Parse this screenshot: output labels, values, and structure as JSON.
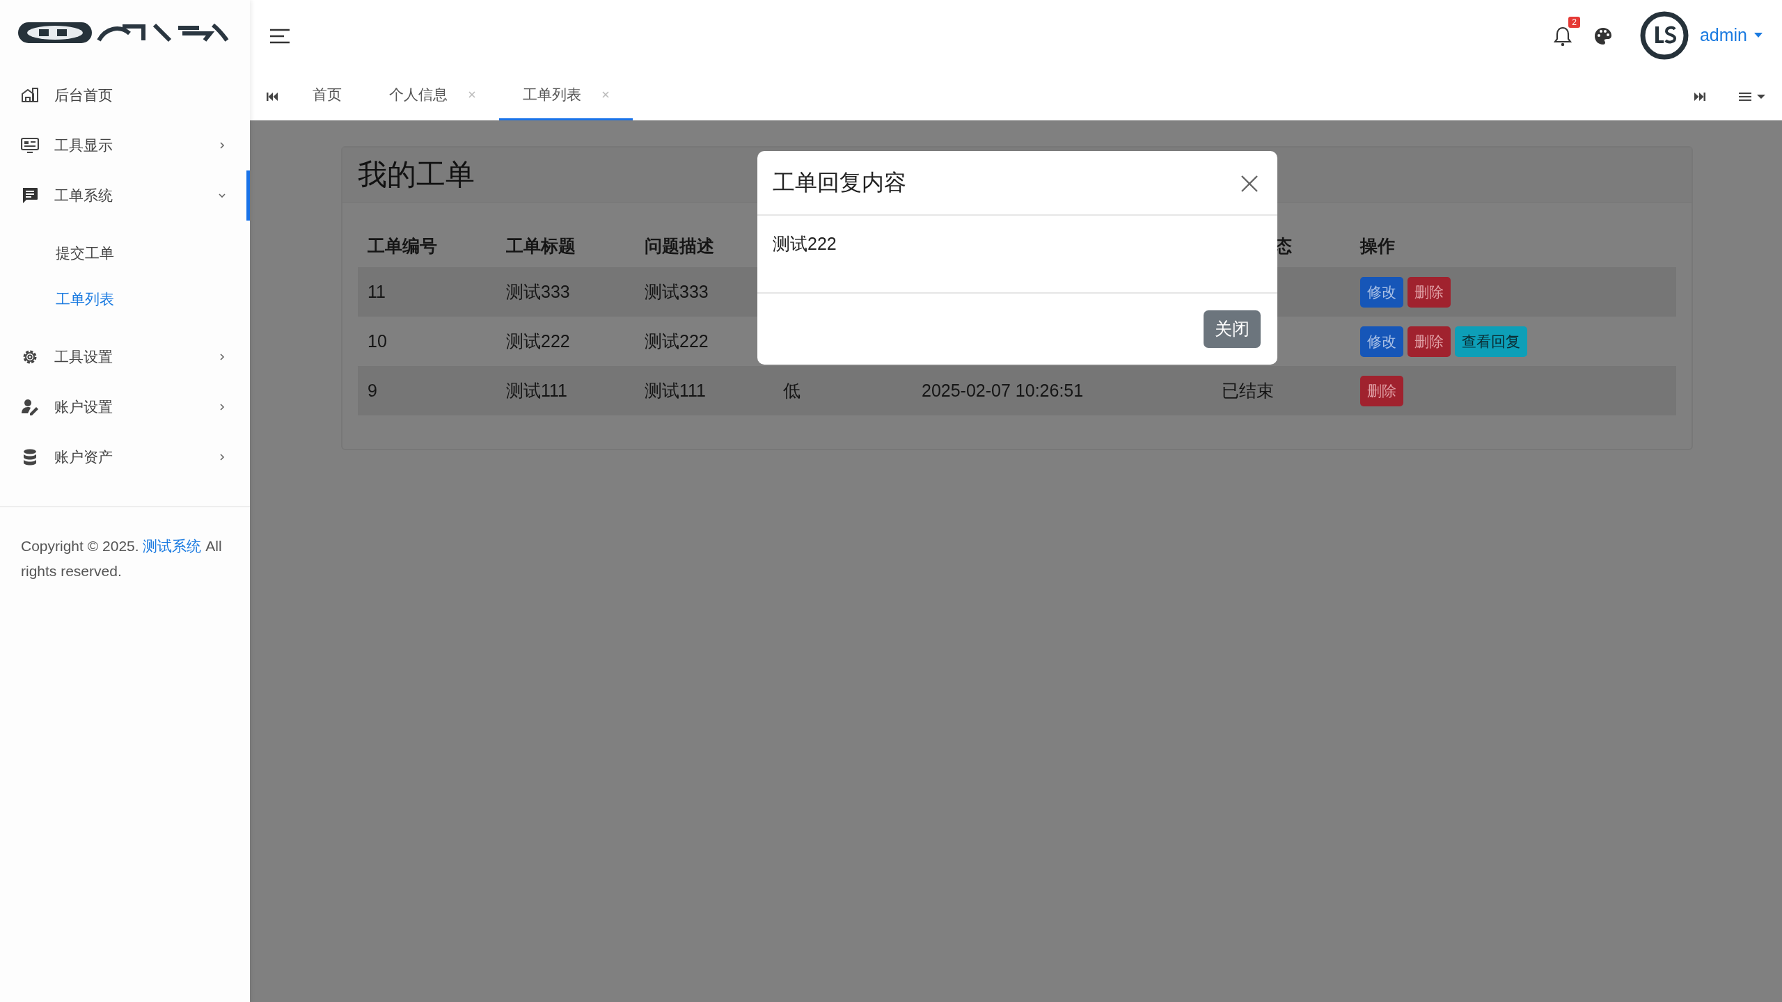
{
  "sidebar": {
    "items": [
      {
        "label": "后台首页",
        "selected": false
      },
      {
        "label": "工具显示",
        "selected": false,
        "expanded": false
      },
      {
        "label": "工单系统",
        "selected": true,
        "expanded": true,
        "children": [
          {
            "label": "提交工单",
            "selected": false
          },
          {
            "label": "工单列表",
            "selected": true
          }
        ]
      },
      {
        "label": "工具设置",
        "selected": false,
        "expanded": false
      },
      {
        "label": "账户设置",
        "selected": false,
        "expanded": false
      },
      {
        "label": "账户资产",
        "selected": false,
        "expanded": false
      }
    ],
    "footer": {
      "before": "Copyright © 2025.",
      "link": "测试系统",
      "after": "All rights reserved."
    }
  },
  "header": {
    "notification_count": "2",
    "user": "admin"
  },
  "tabs": [
    {
      "label": "首页",
      "closable": false,
      "selected": false
    },
    {
      "label": "个人信息",
      "closable": true,
      "selected": false
    },
    {
      "label": "工单列表",
      "closable": true,
      "selected": true
    }
  ],
  "card": {
    "title": "我的工单",
    "table": {
      "columns": [
        "工单编号",
        "工单标题",
        "问题描述",
        null,
        null,
        "态",
        "操作"
      ],
      "rows": [
        {
          "cells": [
            "11",
            "测试333",
            "测试333",
            null,
            null,
            null
          ],
          "actions": [
            {
              "kind": "edit",
              "label": "修改"
            },
            {
              "kind": "delete",
              "label": "删除"
            }
          ]
        },
        {
          "cells": [
            "10",
            "测试222",
            "测试222",
            null,
            null,
            null
          ],
          "actions": [
            {
              "kind": "edit",
              "label": "修改"
            },
            {
              "kind": "delete",
              "label": "删除"
            },
            {
              "kind": "view",
              "label": "查看回复"
            }
          ]
        },
        {
          "cells": [
            "9",
            "测试111",
            "测试111",
            "低",
            "2025-02-07 10:26:51",
            "已结束"
          ],
          "actions": [
            {
              "kind": "delete",
              "label": "删除"
            }
          ]
        }
      ]
    }
  },
  "modal": {
    "title": "工单回复内容",
    "body": "测试222",
    "buttons": [
      "关闭"
    ]
  }
}
